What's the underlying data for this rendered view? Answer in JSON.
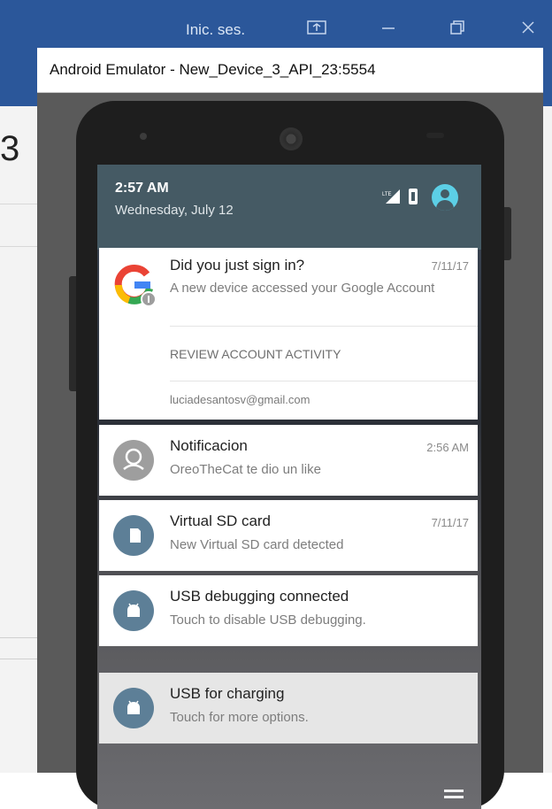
{
  "background_app": {
    "signin_label": "Inic. ses.",
    "doc_fragment": "3"
  },
  "emulator": {
    "window_title": "Android Emulator - New_Device_3_API_23:5554"
  },
  "status": {
    "time": "2:57 AM",
    "date": "Wednesday, July 12"
  },
  "notifications": [
    {
      "title": "Did you just sign in?",
      "text": "A new device accessed your Google Account",
      "time": "7/11/17",
      "action": "REVIEW ACCOUNT ACTIVITY",
      "account": "luciadesantosv@gmail.com",
      "icon": "google-icon"
    },
    {
      "title": "Notificacion",
      "text": "OreoTheCat te dio un like",
      "time": "2:56 AM",
      "icon": "person-icon"
    },
    {
      "title": "Virtual SD card",
      "text": "New Virtual SD card detected",
      "time": "7/11/17",
      "icon": "sd-card-icon"
    },
    {
      "title": "USB debugging connected",
      "text": "Touch to disable USB debugging.",
      "icon": "android-icon"
    },
    {
      "title": "USB for charging",
      "text": "Touch for more options.",
      "icon": "android-icon"
    }
  ],
  "colors": {
    "quick_settings": "#455a64",
    "notification_icon": "#5d7f97",
    "windows_blue": "#2b579a"
  }
}
